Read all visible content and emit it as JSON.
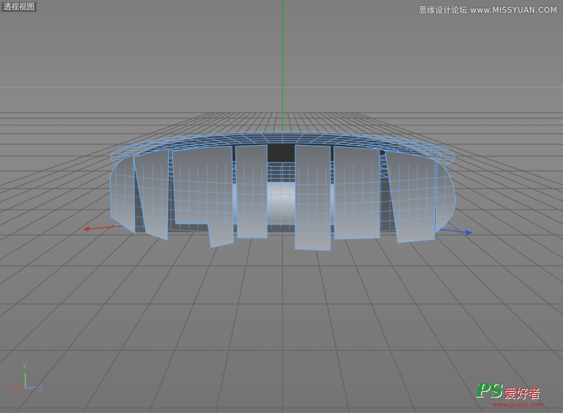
{
  "viewport": {
    "label": "透视视图"
  },
  "watermark_top": "思缘设计论坛 www.MISSYUAN.COM",
  "axis_gizmo": {
    "y": "Y",
    "x": "X",
    "z": "Z"
  },
  "watermark_bottom": {
    "logo": "PS",
    "cn": "爱好者",
    "url": "www.psahz.com"
  },
  "colors": {
    "background": "#7d7d7d",
    "grid": "#5e5e5e",
    "horizon": "#a3a3a3",
    "axis_x": "#c03030",
    "axis_y": "#2fa02f",
    "axis_z": "#3a4fd0",
    "wireframe": "#6fb3ff"
  },
  "icons": [
    "axis-gizmo-icon"
  ]
}
